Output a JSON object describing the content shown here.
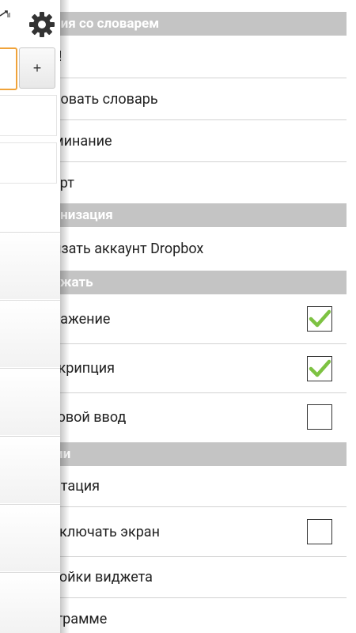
{
  "left_panel": {
    "plus_label": "+"
  },
  "drawer": {
    "sections": [
      {
        "header": "Действия со словарем",
        "items": [
          {
            "label": "Учить!"
          },
          {
            "label": "Копировать словарь"
          },
          {
            "label": "Напоминание"
          },
          {
            "label": "Экспорт"
          }
        ]
      },
      {
        "header": "Синхронизация",
        "items": [
          {
            "label": "Привязать аккаунт Dropbox"
          }
        ]
      },
      {
        "header": "Отображать",
        "items": [
          {
            "label": "Изображение",
            "checked": true
          },
          {
            "label": "Транскрипция",
            "checked": true
          },
          {
            "label": "Голосовой ввод",
            "checked": false
          }
        ]
      },
      {
        "header": "Функции",
        "items": [
          {
            "label": "Ориентация"
          },
          {
            "label": "Не выключать экран",
            "checked": false
          },
          {
            "label": "Настройки виджета"
          },
          {
            "label": "О программе"
          }
        ]
      }
    ]
  },
  "colors": {
    "section_header_bg": "#c4c4c4",
    "check_green": "#7dc242",
    "input_focus_orange": "#f0a33a"
  }
}
